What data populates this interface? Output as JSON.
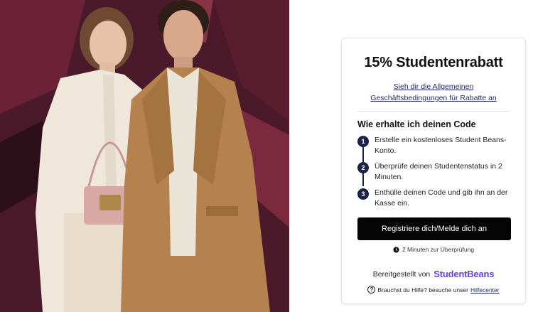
{
  "hero": {
    "description_icon": "fashion-photo"
  },
  "card": {
    "title": "15% Studentenrabatt",
    "terms_link": "Sieh dir die Allgemeinen Geschäftsbedingungen für Rabatte an",
    "steps_title": "Wie erhalte ich deinen Code",
    "steps": [
      {
        "number": "1",
        "text": "Erstelle ein kostenloses Student Beans-Konto."
      },
      {
        "number": "2",
        "text": "Überprüfe deinen Studentenstatus in 2 Minuten."
      },
      {
        "number": "3",
        "text": "Enthülle deinen Code und gib ihn an der Kasse ein."
      }
    ],
    "cta_label": "Registriere dich/Melde dich an",
    "time_note": "2 Minuten zur Überprüfung",
    "provided_by": "Bereitgestellt von",
    "brand": "StudentBeans",
    "help_text": "Brauchst du Hilfe? besuche unser",
    "help_link": "Hilfecenter"
  },
  "colors": {
    "brand": "#6a3ee8",
    "step_badge": "#1b2147",
    "cta_bg": "#050505"
  }
}
